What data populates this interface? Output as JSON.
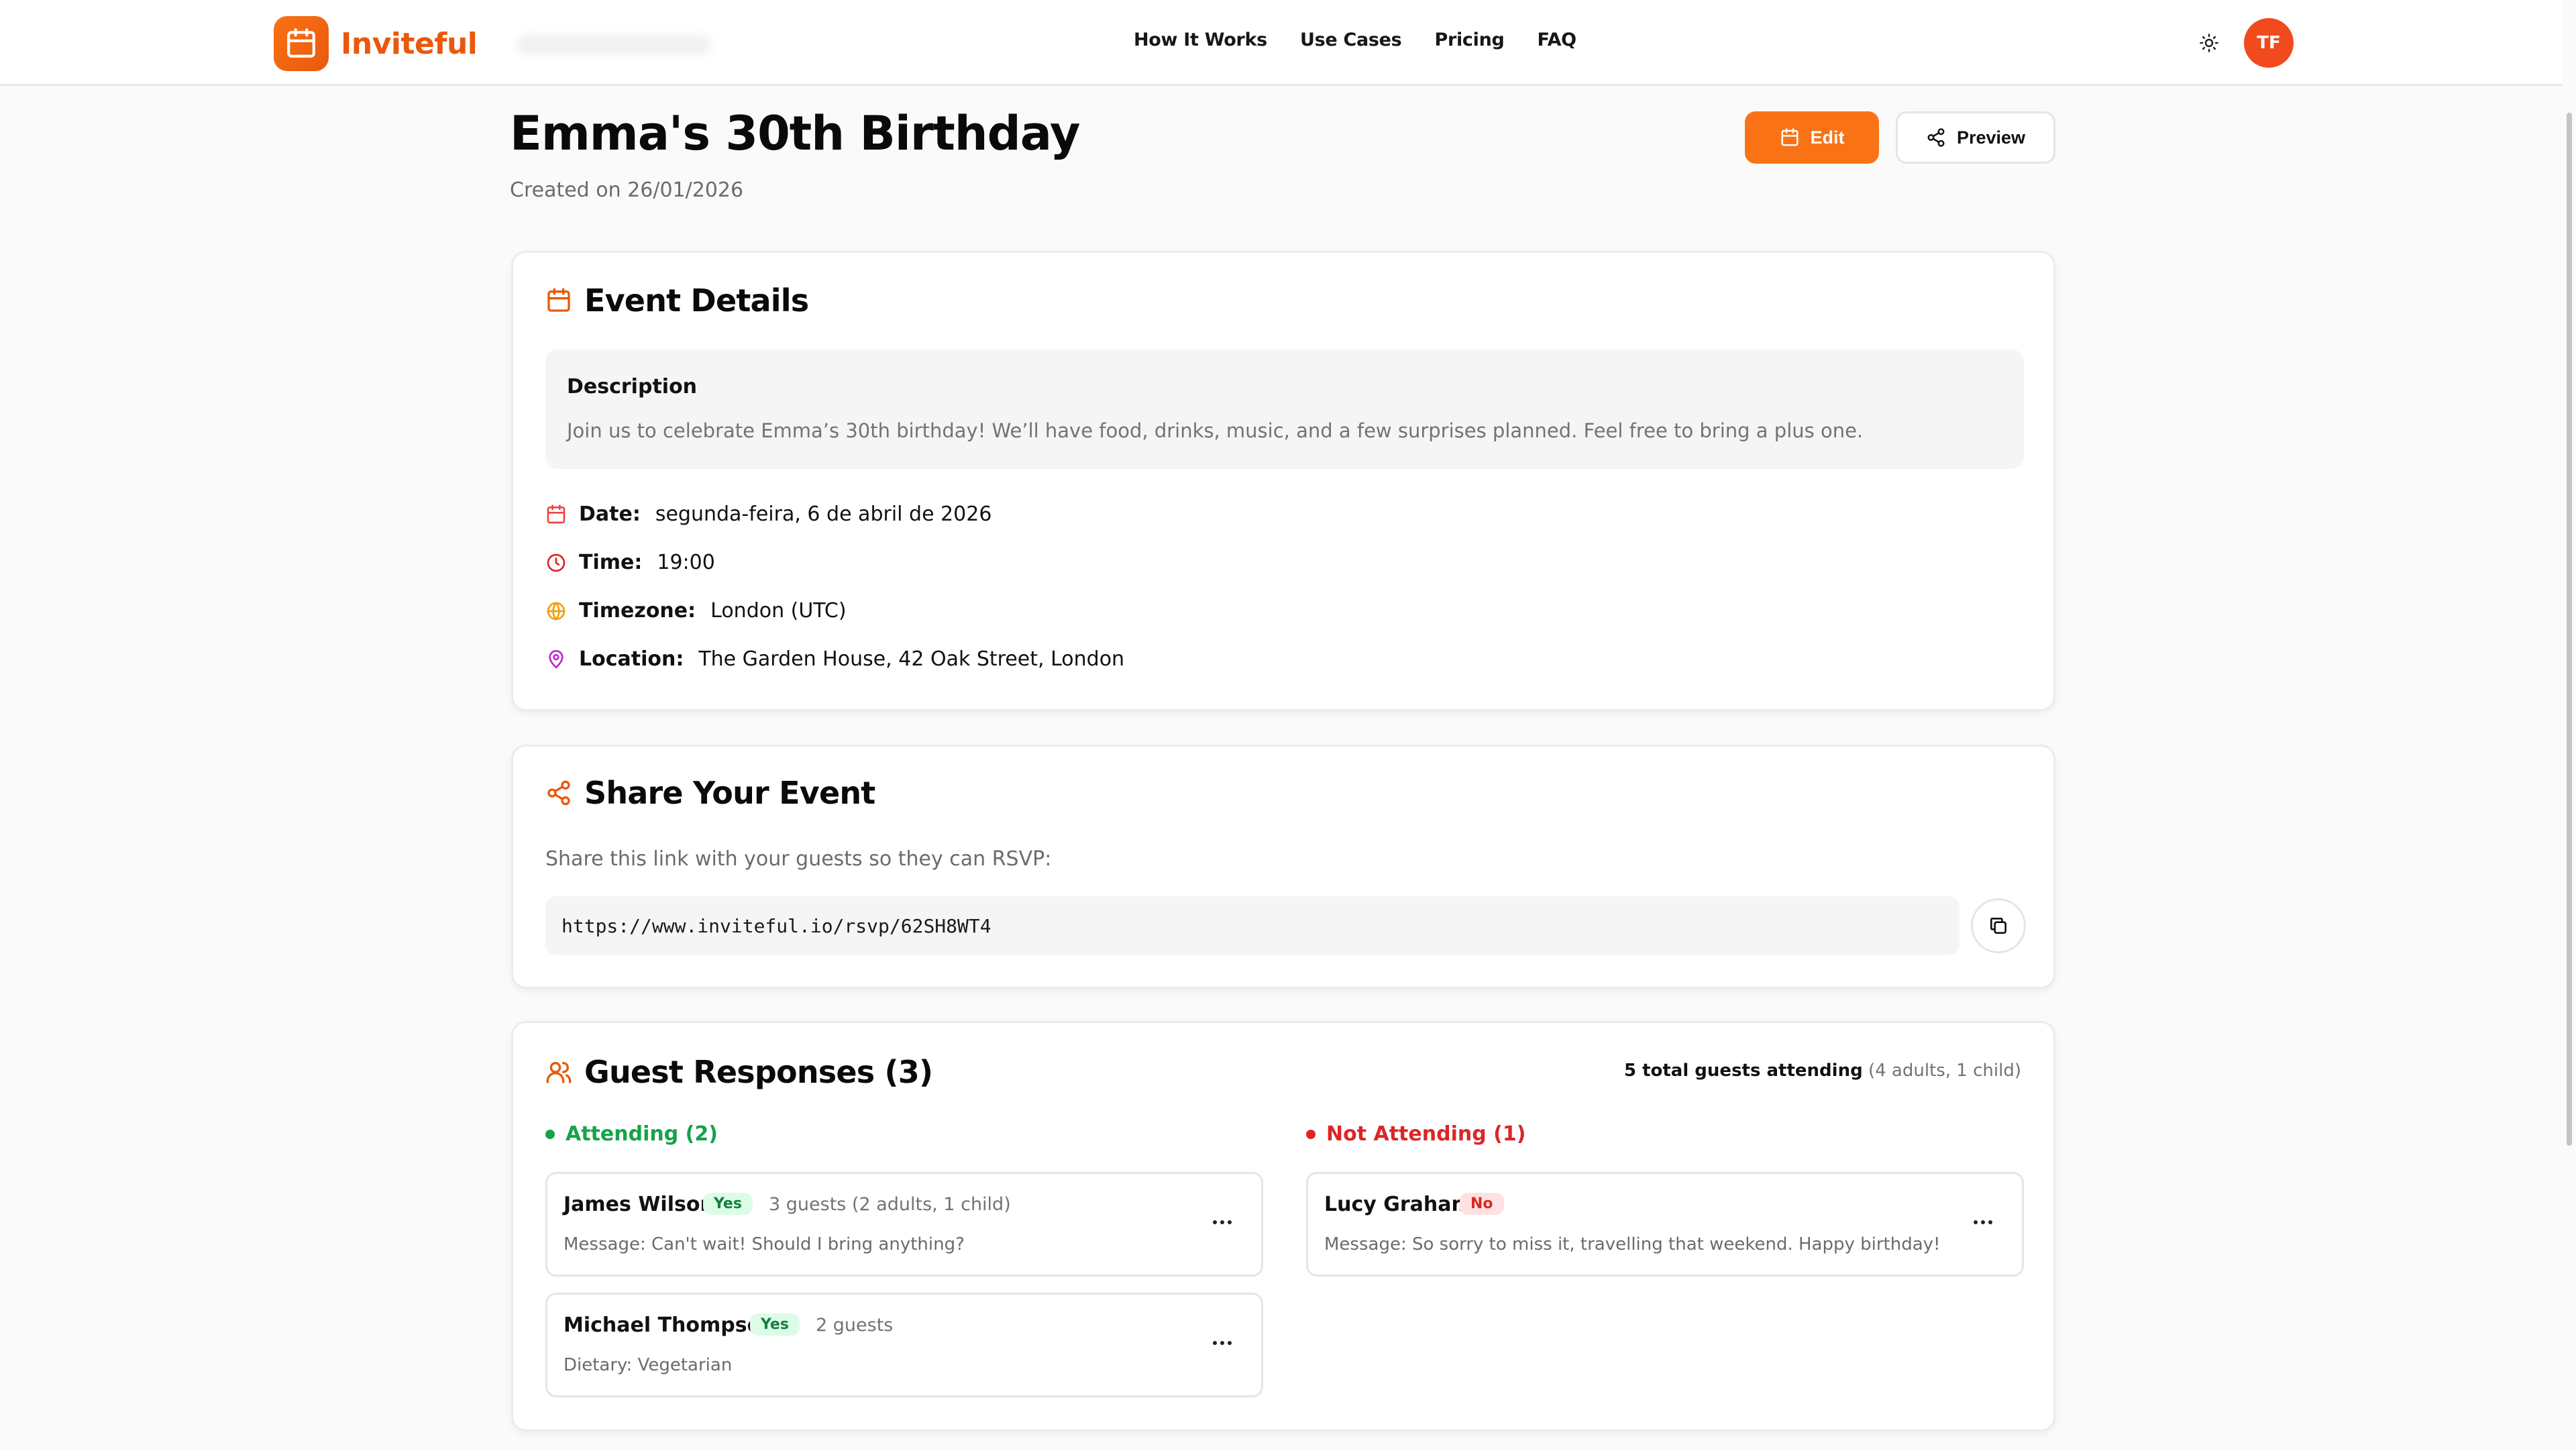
{
  "brand": {
    "name": "Inviteful",
    "icon": "calendar-icon"
  },
  "nav": {
    "items": [
      "How It Works",
      "Use Cases",
      "Pricing",
      "FAQ"
    ]
  },
  "user": {
    "initials": "TF"
  },
  "colors": {
    "accent": "#f97316",
    "accent_dark": "#ea580c",
    "success": "#16a34a",
    "danger": "#dc2626"
  },
  "event": {
    "title": "Emma's 30th Birthday",
    "created": "Created on 26/01/2026",
    "edit_label": "Edit",
    "preview_label": "Preview"
  },
  "details": {
    "title": "Event Details",
    "description_label": "Description",
    "description": "Join us to celebrate Emma’s 30th birthday! We’ll have food, drinks, music, and a few surprises planned. Feel free to bring a plus one.",
    "rows": [
      {
        "label": "Date:",
        "value": "segunda-feira, 6 de abril de 2026",
        "icon": "calendar-icon"
      },
      {
        "label": "Time:",
        "value": "19:00",
        "icon": "clock-icon"
      },
      {
        "label": "Timezone:",
        "value": "London (UTC)",
        "icon": "globe-icon"
      },
      {
        "label": "Location:",
        "value": "The Garden House, 42 Oak Street, London",
        "icon": "map-pin-icon"
      }
    ]
  },
  "share": {
    "title": "Share Your Event",
    "hint": "Share this link with your guests so they can RSVP:",
    "link": "https://www.inviteful.io/rsvp/62SH8WT4"
  },
  "responses": {
    "title": "Guest Responses (3)",
    "totals_strong": "5 total guests attending",
    "totals_muted": "(4 adults, 1 child)",
    "attending_label": "Attending (2)",
    "not_attending_label": "Not Attending (1)",
    "attending": [
      {
        "name": "James Wilson",
        "badge": "Yes",
        "count": "3 guests (2 adults, 1 child)",
        "note": "Message: Can't wait! Should I bring anything?"
      },
      {
        "name": "Michael Thompson",
        "badge": "Yes",
        "count": "2 guests",
        "note": "Dietary: Vegetarian"
      }
    ],
    "not_attending": [
      {
        "name": "Lucy Graham",
        "badge": "No",
        "count": "",
        "note": "Message: So sorry to miss it, travelling that weekend. Happy birthday!"
      }
    ]
  }
}
